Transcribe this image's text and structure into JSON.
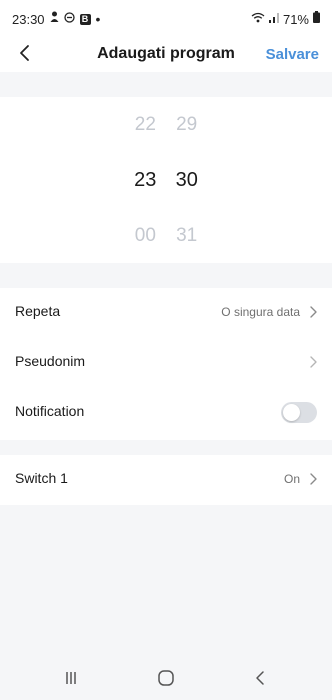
{
  "status_bar": {
    "time": "23:30",
    "icons_left": [
      "notification-icon",
      "do-not-disturb-icon",
      "b-app-icon",
      "dot-icon"
    ],
    "icons_right": [
      "wifi-icon",
      "signal-icon",
      "battery-icon"
    ],
    "battery": "71%"
  },
  "header": {
    "title": "Adaugati program",
    "save_label": "Salvare",
    "accent_color": "#4a90d9"
  },
  "time_picker": {
    "hours": [
      "22",
      "23",
      "00"
    ],
    "minutes": [
      "29",
      "30",
      "31"
    ],
    "selected_hour": "23",
    "selected_minute": "30"
  },
  "settings": {
    "repeat": {
      "label": "Repeta",
      "value": "O singura data"
    },
    "alias": {
      "label": "Pseudonim",
      "value": ""
    },
    "notification": {
      "label": "Notification",
      "enabled": false
    }
  },
  "switch": {
    "label": "Switch 1",
    "value": "On"
  },
  "nav_bar": {
    "buttons": [
      "recent-apps-icon",
      "home-icon",
      "back-icon"
    ]
  }
}
